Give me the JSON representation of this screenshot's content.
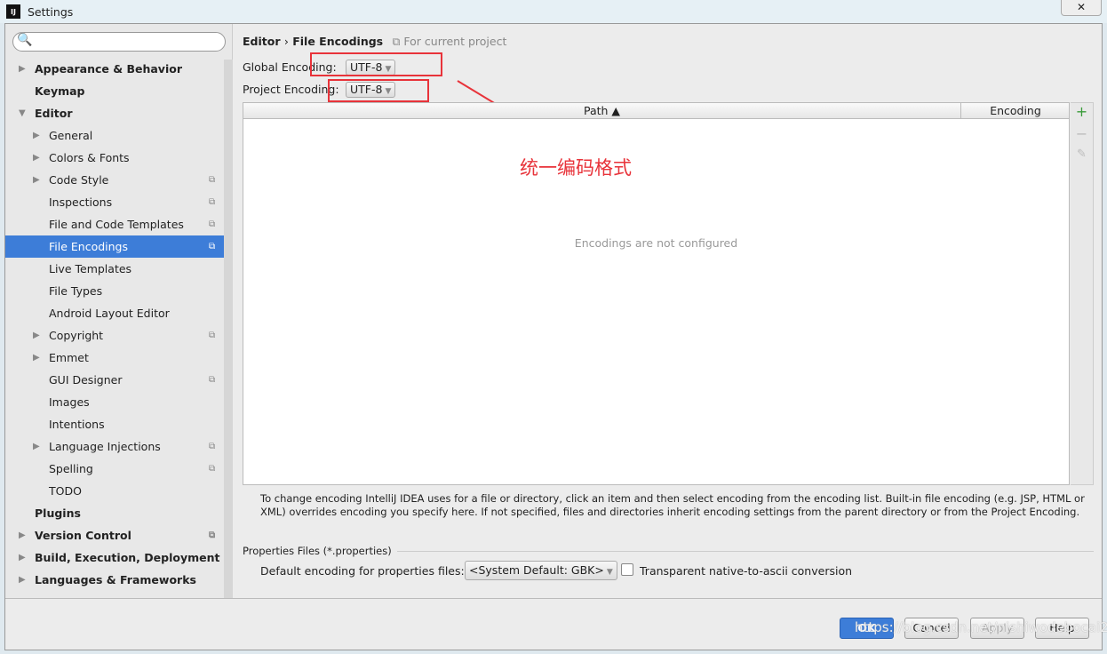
{
  "window": {
    "title": "Settings",
    "close": "✕"
  },
  "search": {
    "placeholder": ""
  },
  "sidebar": {
    "items": [
      {
        "label": "Appearance & Behavior",
        "level": 1,
        "bold": true,
        "arrow": "▶"
      },
      {
        "label": "Keymap",
        "level": 1,
        "bold": true
      },
      {
        "label": "Editor",
        "level": 1,
        "bold": true,
        "arrow": "▼"
      },
      {
        "label": "General",
        "level": 2,
        "arrow": "▶"
      },
      {
        "label": "Colors & Fonts",
        "level": 2,
        "arrow": "▶"
      },
      {
        "label": "Code Style",
        "level": 2,
        "arrow": "▶",
        "copy": true
      },
      {
        "label": "Inspections",
        "level": 2,
        "copy": true
      },
      {
        "label": "File and Code Templates",
        "level": 2,
        "copy": true
      },
      {
        "label": "File Encodings",
        "level": 2,
        "copy": true,
        "selected": true
      },
      {
        "label": "Live Templates",
        "level": 2
      },
      {
        "label": "File Types",
        "level": 2
      },
      {
        "label": "Android Layout Editor",
        "level": 2
      },
      {
        "label": "Copyright",
        "level": 2,
        "arrow": "▶",
        "copy": true
      },
      {
        "label": "Emmet",
        "level": 2,
        "arrow": "▶"
      },
      {
        "label": "GUI Designer",
        "level": 2,
        "copy": true
      },
      {
        "label": "Images",
        "level": 2
      },
      {
        "label": "Intentions",
        "level": 2
      },
      {
        "label": "Language Injections",
        "level": 2,
        "arrow": "▶",
        "copy": true
      },
      {
        "label": "Spelling",
        "level": 2,
        "copy": true
      },
      {
        "label": "TODO",
        "level": 2
      },
      {
        "label": "Plugins",
        "level": 1,
        "bold": true
      },
      {
        "label": "Version Control",
        "level": 1,
        "bold": true,
        "arrow": "▶",
        "copy": true
      },
      {
        "label": "Build, Execution, Deployment",
        "level": 1,
        "bold": true,
        "arrow": "▶"
      },
      {
        "label": "Languages & Frameworks",
        "level": 1,
        "bold": true,
        "arrow": "▶"
      }
    ]
  },
  "breadcrumb": {
    "parent": "Editor",
    "sep": "›",
    "current": "File Encodings",
    "scope": "For current project"
  },
  "global_encoding": {
    "label": "Global Encoding:",
    "value": "UTF-8"
  },
  "project_encoding": {
    "label": "Project Encoding:",
    "value": "UTF-8"
  },
  "table": {
    "columns": [
      "Path ▲",
      "Encoding"
    ],
    "empty": "Encodings are not configured"
  },
  "annotation": "统一编码格式",
  "note": "To change encoding IntelliJ IDEA uses for a file or directory, click an item and then select encoding from the encoding list. Built-in file encoding (e.g. JSP, HTML or XML) overrides encoding you specify here. If not specified, files and directories inherit encoding settings from the parent directory or from the Project Encoding.",
  "properties": {
    "section": "Properties Files (*.properties)",
    "label": "Default encoding for properties files:",
    "value": "<System Default: GBK>",
    "checkbox_label": "Transparent native-to-ascii conversion",
    "checked": false
  },
  "buttons": {
    "ok": "OK",
    "cancel": "Cancel",
    "apply": "Apply",
    "help": "Help"
  },
  "watermark": "https://blog.csdn.net/nishiwodebocai21",
  "colors": {
    "accent": "#3d7dd8",
    "annotation": "#e8333a"
  }
}
